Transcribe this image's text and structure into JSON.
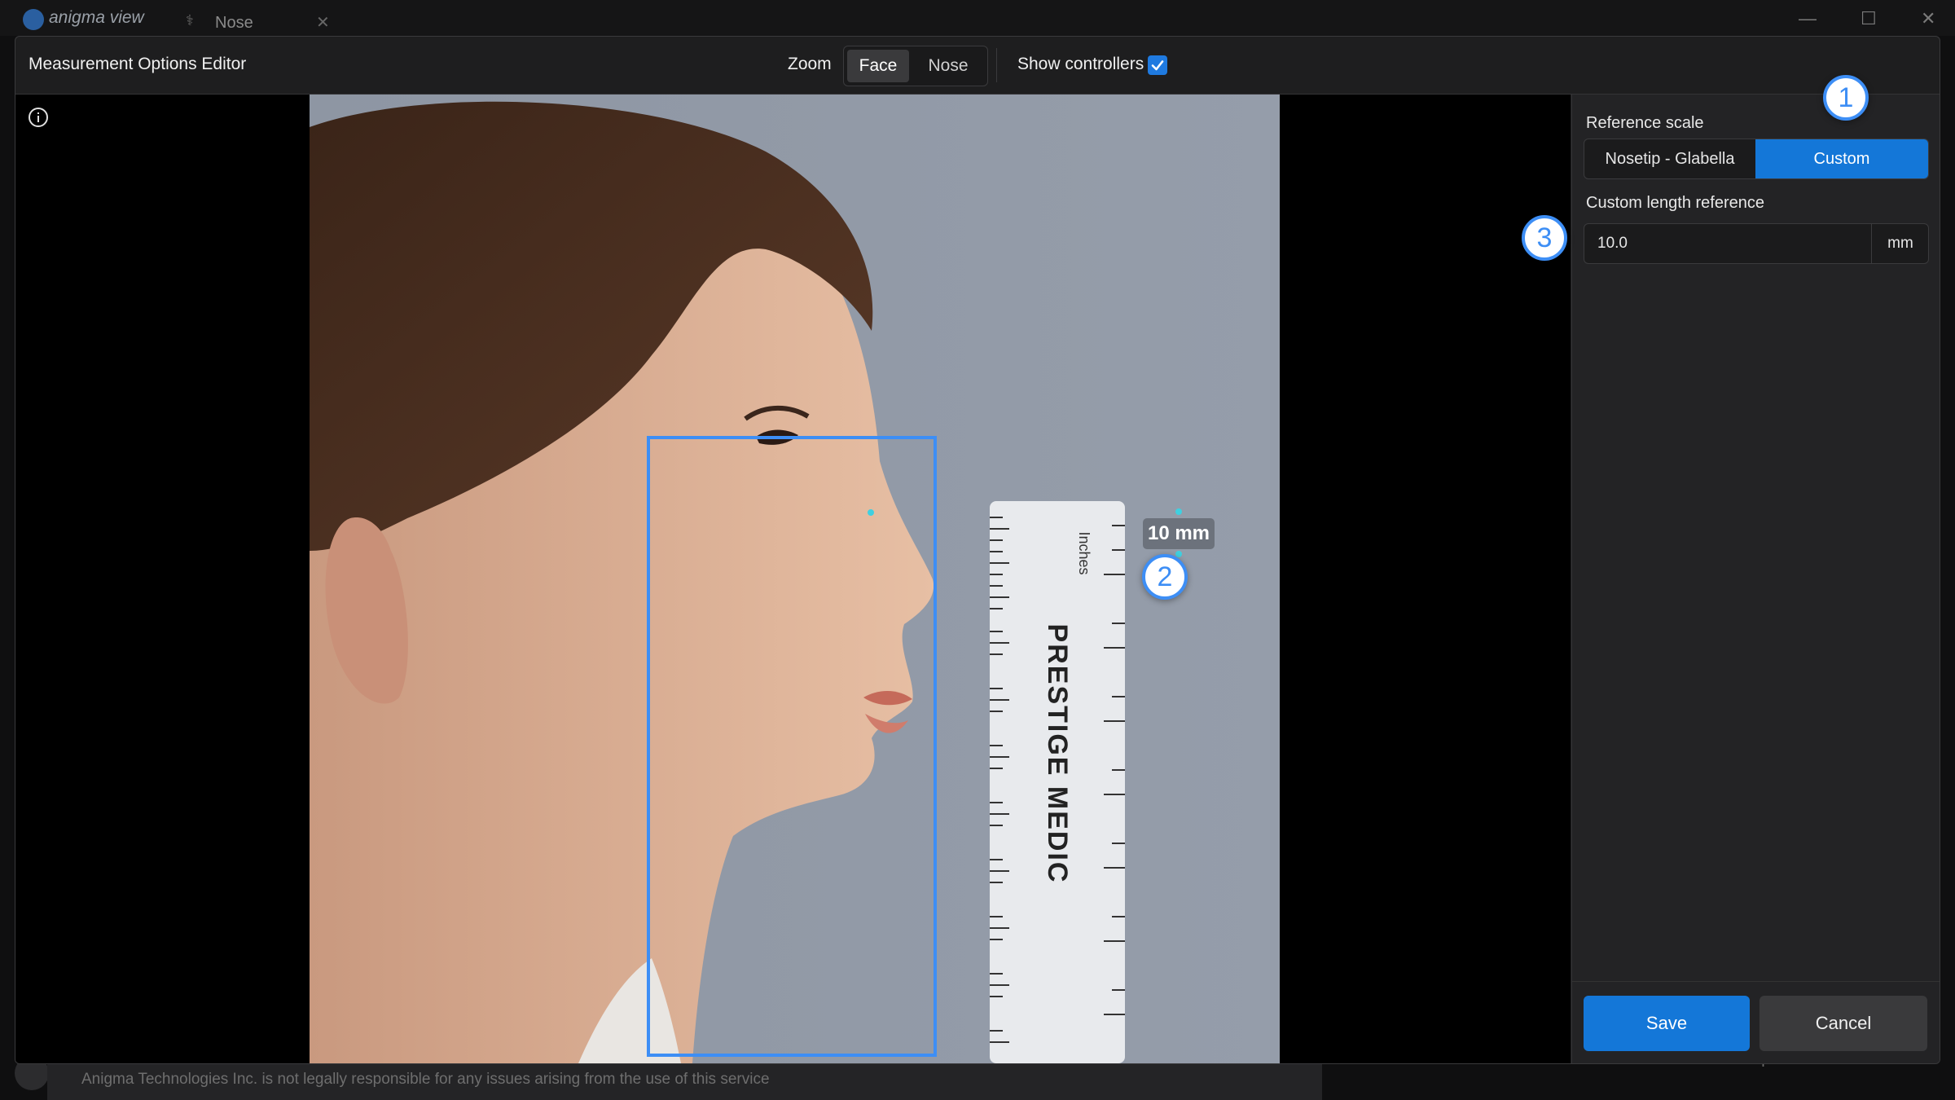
{
  "app": {
    "name": "anigma view",
    "background_tab": "Nose",
    "footer_notice": "Anigma Technologies Inc. is not legally responsible for any issues arising from the use of this service",
    "footer_right": "Compare"
  },
  "dialog": {
    "title": "Measurement Options Editor",
    "zoom": {
      "label": "Zoom",
      "options": [
        "Face",
        "Nose"
      ],
      "selected": "Face"
    },
    "show_controllers": {
      "label": "Show controllers",
      "checked": true
    }
  },
  "viewer": {
    "measure_label": "10 mm",
    "ruler_text": "PRESTIGE MEDIC",
    "ruler_units": "Inches"
  },
  "callouts": {
    "c1": "1",
    "c2": "2",
    "c3": "3"
  },
  "panel": {
    "reference_scale_label": "Reference scale",
    "reference_options": [
      "Nosetip - Glabella",
      "Custom"
    ],
    "reference_selected": "Custom",
    "custom_length_label": "Custom length reference",
    "custom_length_value": "10.0",
    "unit": "mm",
    "save_label": "Save",
    "cancel_label": "Cancel"
  },
  "colors": {
    "accent": "#1477d8",
    "callout": "#3d8ef5",
    "roi": "#3d8ef5"
  }
}
